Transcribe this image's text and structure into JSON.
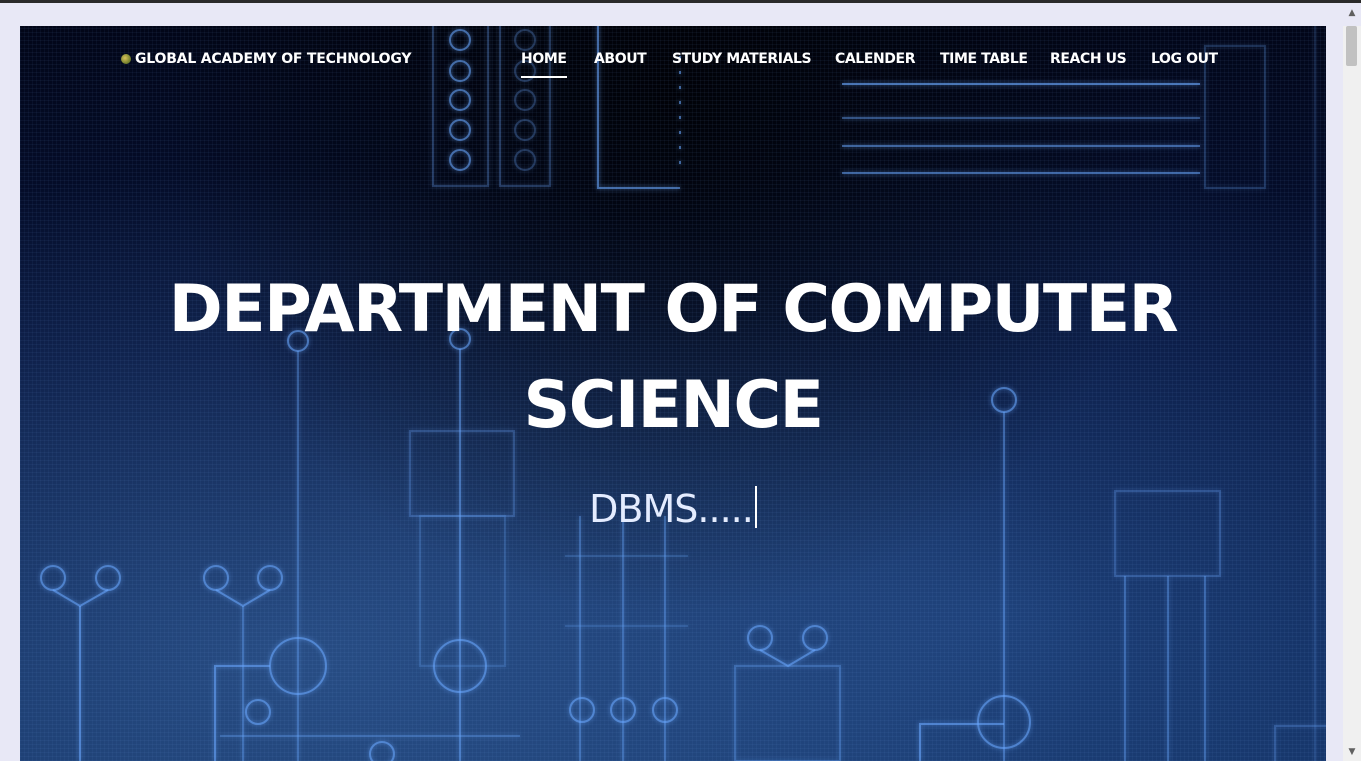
{
  "header": {
    "brand": "GLOBAL ACADEMY OF TECHNOLOGY",
    "logo_icon": "college-emblem-icon"
  },
  "nav": {
    "items": [
      {
        "label": "HOME",
        "active": true
      },
      {
        "label": "ABOUT",
        "active": false
      },
      {
        "label": "STUDY MATERIALS",
        "active": false
      },
      {
        "label": "CALENDER",
        "active": false
      },
      {
        "label": "TIME TABLE",
        "active": false
      },
      {
        "label": "REACH US",
        "active": false
      },
      {
        "label": "LOG OUT",
        "active": false
      }
    ]
  },
  "hero": {
    "title_line1": "DEPARTMENT OF COMPUTER",
    "title_line2": "SCIENCE",
    "typing_text": "DBMS....."
  },
  "colors": {
    "background": "#06133a",
    "text": "#ffffff",
    "circuit_glow": "#6aa8ff"
  }
}
